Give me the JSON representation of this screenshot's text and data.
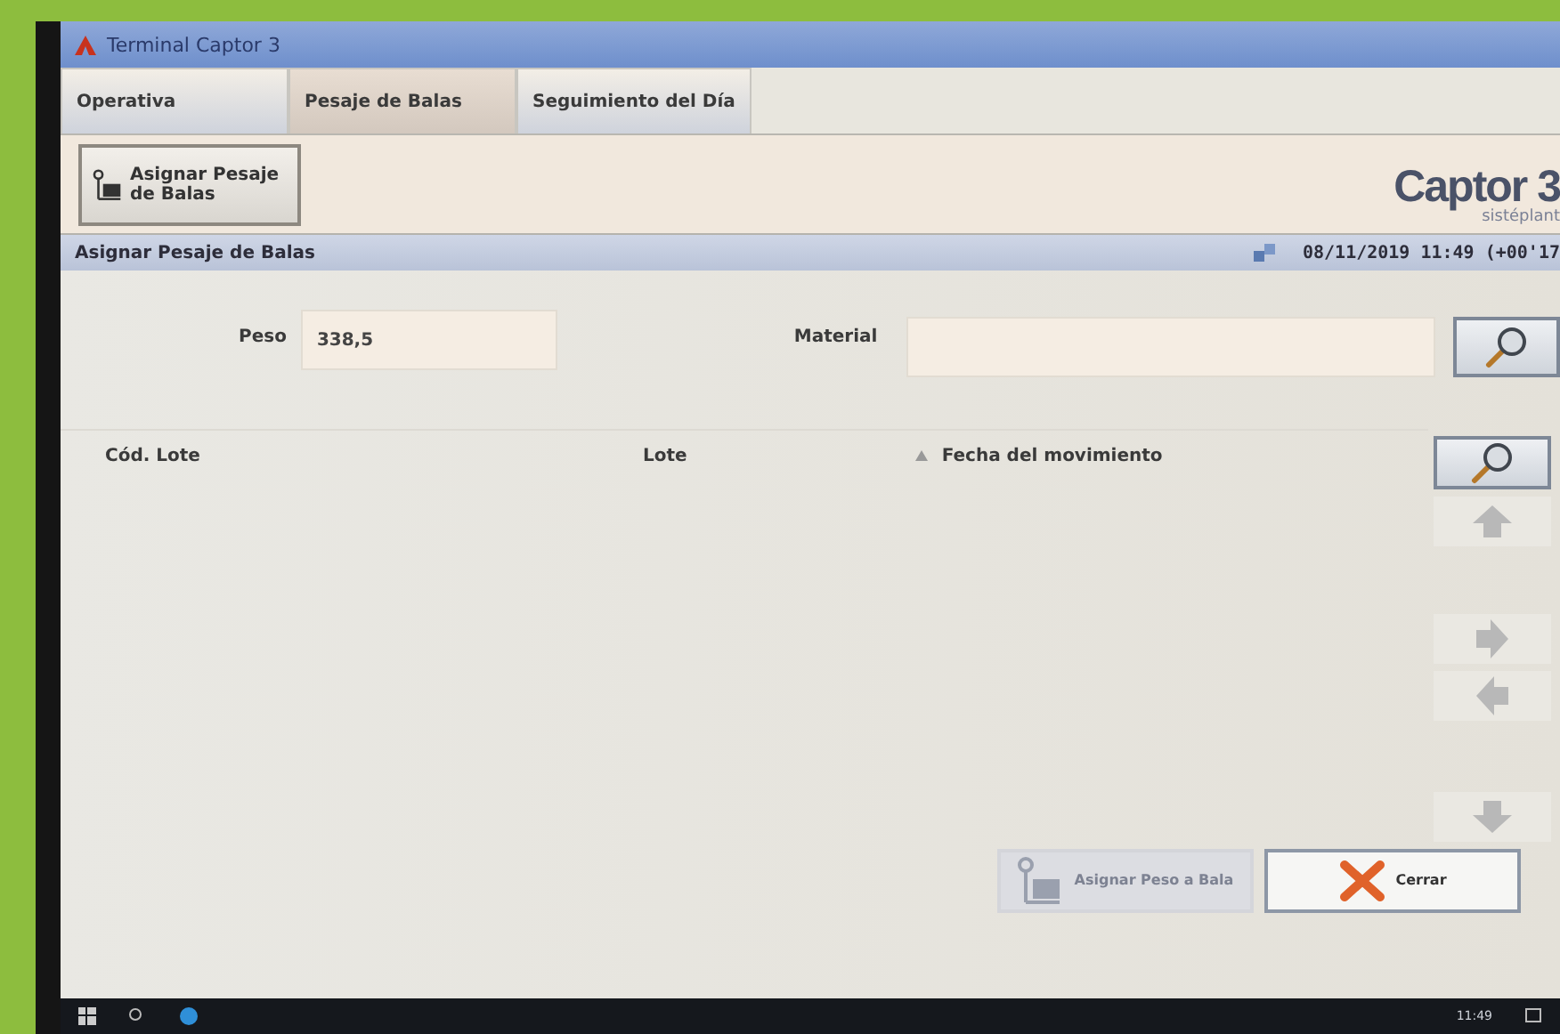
{
  "window": {
    "title": "Terminal Captor 3"
  },
  "tabs": [
    {
      "label": "Operativa",
      "selected": false
    },
    {
      "label": "Pesaje de Balas",
      "selected": true
    },
    {
      "label": "Seguimiento del Día",
      "selected": false
    }
  ],
  "toolbar": {
    "buttons": [
      {
        "label": "Asignar Pesaje de Balas"
      }
    ]
  },
  "logo": {
    "name": "Captor 3",
    "tagline": "sistéplant"
  },
  "section": {
    "title": "Asignar Pesaje de Balas",
    "timestamp": "08/11/2019 11:49 (+00'17"
  },
  "form": {
    "fields": [
      {
        "label": "Peso",
        "value": "338,5"
      },
      {
        "label": "Material"
      }
    ]
  },
  "table": {
    "columns": [
      {
        "label": "Cód. Lote",
        "sorted": false
      },
      {
        "label": "Lote",
        "sorted": false
      },
      {
        "label": "Fecha del movimiento",
        "sorted": true
      }
    ]
  },
  "side_buttons": [
    {
      "kind": "search"
    },
    {
      "kind": "up"
    },
    {
      "kind": "right"
    },
    {
      "kind": "left"
    },
    {
      "kind": "down"
    }
  ],
  "actions": [
    {
      "label": "Asignar Peso a Bala",
      "kind": "scale",
      "disabled": true
    },
    {
      "label": "Cerrar",
      "kind": "close",
      "disabled": false
    }
  ],
  "taskbar": {
    "time": "11:49"
  }
}
